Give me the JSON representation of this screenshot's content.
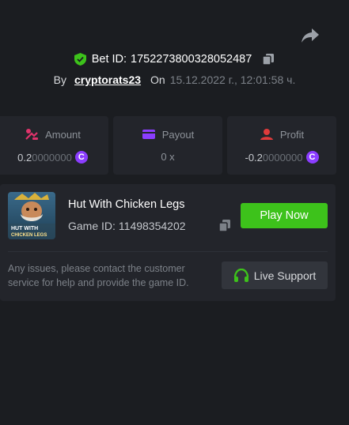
{
  "bet": {
    "id_label": "Bet ID:",
    "id_value": "1752273800328052487",
    "by_label": "By",
    "username": "cryptorats23",
    "on_label": "On",
    "datetime": "15.12.2022 г., 12:01:58 ч."
  },
  "stats": {
    "amount": {
      "label": "Amount",
      "value_bright": "0.2",
      "value_dim": "0000000",
      "currency_icon": "coin-icon"
    },
    "payout": {
      "label": "Payout",
      "value": "0 x"
    },
    "profit": {
      "label": "Profit",
      "value_bright": "-0.2",
      "value_dim": "0000000",
      "currency_icon": "coin-icon"
    }
  },
  "game": {
    "name": "Hut With Chicken Legs",
    "id_label": "Game ID:",
    "id_value": "11498354202",
    "thumb_title_line1": "HUT WITH",
    "thumb_title_line2": "CHICKEN LEGS",
    "play_label": "Play Now"
  },
  "support": {
    "notice": "Any issues, please contact the customer service for help and provide the game ID.",
    "button_label": "Live Support"
  },
  "colors": {
    "background": "#1b1d21",
    "card": "#23252b",
    "play_green": "#3dc21b",
    "coin_purple": "#8b3dff",
    "shield_green": "#3dc21b",
    "amount_icon": "#e0336b",
    "payout_icon": "#8b3dff",
    "profit_icon": "#e03b3b"
  }
}
